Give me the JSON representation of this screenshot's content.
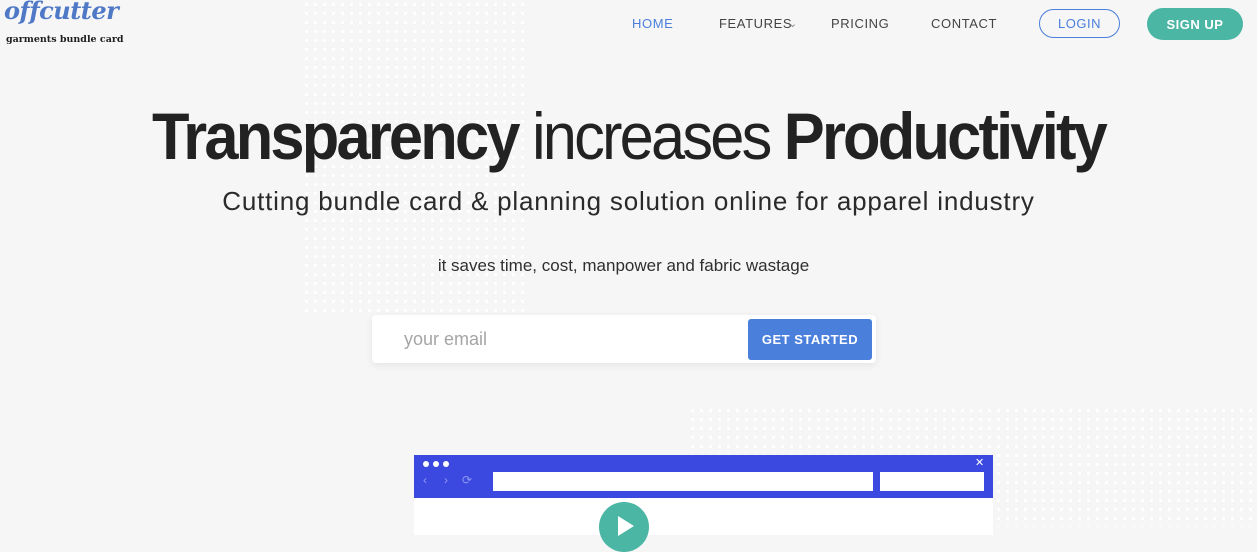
{
  "brand": {
    "logo_text": "offcutter",
    "tagline": "garments bundle card",
    "color": "#4f79c6"
  },
  "nav": {
    "items": [
      {
        "label": "HOME",
        "active": true
      },
      {
        "label": "FEATURES",
        "has_dropdown": true
      },
      {
        "label": "PRICING"
      },
      {
        "label": "CONTACT"
      }
    ],
    "login_label": "LOGIN",
    "signup_label": "SIGN UP",
    "accent_color": "#4a7fdc",
    "signup_color": "#4bb6a4"
  },
  "hero": {
    "title_part1": "Transparency",
    "title_part2": "increases",
    "title_part3": "Productivity",
    "subtitle": "Cutting bundle card & planning solution online for apparel industry",
    "note": "it saves time, cost, manpower and fabric wastage"
  },
  "form": {
    "email_placeholder": "your email",
    "email_value": "",
    "button_label": "GET STARTED"
  },
  "mockup": {
    "bar_color": "#3c49e0",
    "icons": [
      "window-dots-icon",
      "back-arrow-icon",
      "forward-arrow-icon",
      "reload-icon",
      "close-icon",
      "play-icon"
    ]
  }
}
